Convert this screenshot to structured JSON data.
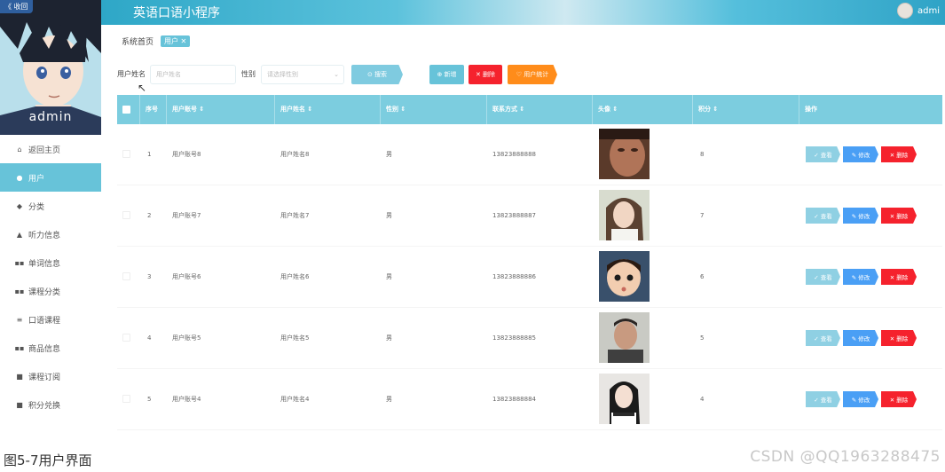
{
  "sidebar": {
    "collapse_label": "《 收回",
    "username": "admin",
    "items": [
      {
        "icon": "home-icon",
        "glyph": "⌂",
        "label": "返回主页",
        "active": false
      },
      {
        "icon": "user-icon",
        "glyph": "●",
        "label": "用户",
        "active": true
      },
      {
        "icon": "category-icon",
        "glyph": "◆",
        "label": "分类",
        "active": false
      },
      {
        "icon": "person-icon",
        "glyph": "▲",
        "label": "听力信息",
        "active": false
      },
      {
        "icon": "grid-icon",
        "glyph": "▪▪",
        "label": "单词信息",
        "active": false
      },
      {
        "icon": "grid-icon",
        "glyph": "▪▪",
        "label": "课程分类",
        "active": false
      },
      {
        "icon": "list-icon",
        "glyph": "≡",
        "label": "口语课程",
        "active": false
      },
      {
        "icon": "grid-icon",
        "glyph": "▪▪",
        "label": "商品信息",
        "active": false
      },
      {
        "icon": "chat-icon",
        "glyph": "■",
        "label": "课程订阅",
        "active": false
      },
      {
        "icon": "chat-icon",
        "glyph": "■",
        "label": "积分兑换",
        "active": false
      }
    ]
  },
  "header": {
    "title": "英语口语小程序",
    "user": "admi"
  },
  "breadcrumb": {
    "home": "系统首页",
    "current": "用户 ✕"
  },
  "search": {
    "name_label": "用户姓名",
    "name_placeholder": "用户姓名",
    "gender_label": "性别",
    "gender_placeholder": "请选择性别",
    "search_label": "⊙ 搜索",
    "add_label": "⊕ 新增",
    "delete_label": "✕ 删除",
    "stats_label": "♡ 用户统计"
  },
  "table": {
    "headers": [
      "序号",
      "用户账号 ⇕",
      "用户姓名 ⇕",
      "性别 ⇕",
      "联系方式 ⇕",
      "头像 ⇕",
      "积分 ⇕",
      "操作"
    ],
    "rows": [
      {
        "index": "1",
        "account": "用户账号8",
        "name": "用户姓名8",
        "gender": "男",
        "phone": "13823888888",
        "points": "8"
      },
      {
        "index": "2",
        "account": "用户账号7",
        "name": "用户姓名7",
        "gender": "男",
        "phone": "13823888887",
        "points": "7"
      },
      {
        "index": "3",
        "account": "用户账号6",
        "name": "用户姓名6",
        "gender": "男",
        "phone": "13823888886",
        "points": "6"
      },
      {
        "index": "4",
        "account": "用户账号5",
        "name": "用户姓名5",
        "gender": "男",
        "phone": "13823888885",
        "points": "5"
      },
      {
        "index": "5",
        "account": "用户账号4",
        "name": "用户姓名4",
        "gender": "男",
        "phone": "13823888884",
        "points": "4"
      }
    ],
    "op_view": "✓ 查看",
    "op_edit": "✎ 修改",
    "op_delete": "✕ 删除"
  },
  "caption": "图5-7用户界面",
  "watermark": "CSDN @QQ1963288475",
  "colors": {
    "accent": "#67c3d9",
    "danger": "#f5222d",
    "warning": "#ff8c1a",
    "edit": "#4a9ff5"
  }
}
